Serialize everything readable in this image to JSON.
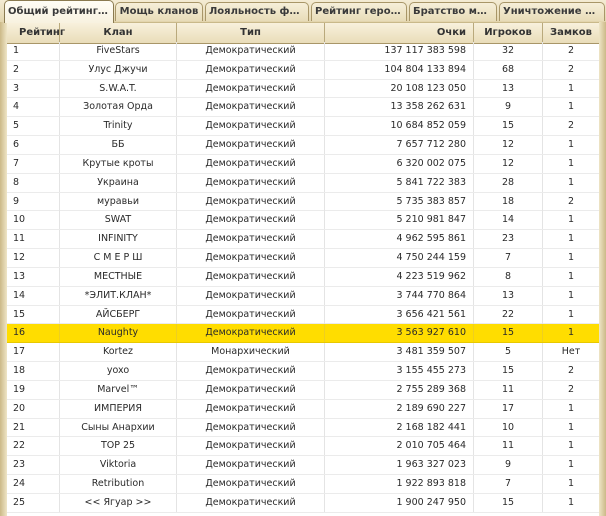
{
  "tabs": [
    {
      "label": "Общий рейтинг ...",
      "active": true
    },
    {
      "label": "Мощь кланов",
      "active": false
    },
    {
      "label": "Лояльность фр...",
      "active": false
    },
    {
      "label": "Рейтинг героев",
      "active": false
    },
    {
      "label": "Братство меча",
      "active": false
    },
    {
      "label": "Уничтожение р...",
      "active": false
    }
  ],
  "columns": {
    "rank": "Рейтинг",
    "clan": "Клан",
    "type": "Тип",
    "points": "Очки",
    "players": "Игроков",
    "castles": "Замков"
  },
  "highlight_color": "#ffdd00",
  "rows": [
    {
      "rank": "1",
      "clan": "FiveStars",
      "type": "Демократический",
      "points": "137 117 383 598",
      "players": "32",
      "castles": "2"
    },
    {
      "rank": "2",
      "clan": "Улус Джучи",
      "type": "Демократический",
      "points": "104 804 133 894",
      "players": "68",
      "castles": "2"
    },
    {
      "rank": "3",
      "clan": "S.W.A.T.",
      "type": "Демократический",
      "points": "20 108 123 050",
      "players": "13",
      "castles": "1"
    },
    {
      "rank": "4",
      "clan": "Золотая Орда",
      "type": "Демократический",
      "points": "13 358 262 631",
      "players": "9",
      "castles": "1"
    },
    {
      "rank": "5",
      "clan": "Trinity",
      "type": "Демократический",
      "points": "10 684 852 059",
      "players": "15",
      "castles": "2"
    },
    {
      "rank": "6",
      "clan": "ББ",
      "type": "Демократический",
      "points": "7 657 712 280",
      "players": "12",
      "castles": "1"
    },
    {
      "rank": "7",
      "clan": "Крутые кроты",
      "type": "Демократический",
      "points": "6 320 002 075",
      "players": "12",
      "castles": "1"
    },
    {
      "rank": "8",
      "clan": "Украина",
      "type": "Демократический",
      "points": "5 841 722 383",
      "players": "28",
      "castles": "1"
    },
    {
      "rank": "9",
      "clan": "муравьи",
      "type": "Демократический",
      "points": "5 735 383 857",
      "players": "18",
      "castles": "2"
    },
    {
      "rank": "10",
      "clan": "SWAT",
      "type": "Демократический",
      "points": "5 210 981 847",
      "players": "14",
      "castles": "1"
    },
    {
      "rank": "11",
      "clan": "INFINITY",
      "type": "Демократический",
      "points": "4 962 595 861",
      "players": "23",
      "castles": "1"
    },
    {
      "rank": "12",
      "clan": "С М Е Р Ш",
      "type": "Демократический",
      "points": "4 750 244 159",
      "players": "7",
      "castles": "1"
    },
    {
      "rank": "13",
      "clan": "МЕСТНЫЕ",
      "type": "Демократический",
      "points": "4 223 519 962",
      "players": "8",
      "castles": "1"
    },
    {
      "rank": "14",
      "clan": "*ЭЛИТ.КЛАН*",
      "type": "Демократический",
      "points": "3 744 770 864",
      "players": "13",
      "castles": "1"
    },
    {
      "rank": "15",
      "clan": "АЙСБЕРГ",
      "type": "Демократический",
      "points": "3 656 421 561",
      "players": "22",
      "castles": "1"
    },
    {
      "rank": "16",
      "clan": "Naughty",
      "type": "Демократический",
      "points": "3 563 927 610",
      "players": "15",
      "castles": "1",
      "highlighted": true
    },
    {
      "rank": "17",
      "clan": "Kortez",
      "type": "Монархический",
      "points": "3 481 359 507",
      "players": "5",
      "castles": "Нет"
    },
    {
      "rank": "18",
      "clan": "yoxo",
      "type": "Демократический",
      "points": "3 155 455 273",
      "players": "15",
      "castles": "2"
    },
    {
      "rank": "19",
      "clan": "Marvel™",
      "type": "Демократический",
      "points": "2 755 289 368",
      "players": "11",
      "castles": "2"
    },
    {
      "rank": "20",
      "clan": "ИМПЕРИЯ",
      "type": "Демократический",
      "points": "2 189 690 227",
      "players": "17",
      "castles": "1"
    },
    {
      "rank": "21",
      "clan": "Сыны Анархии",
      "type": "Демократический",
      "points": "2 168 182 441",
      "players": "10",
      "castles": "1"
    },
    {
      "rank": "22",
      "clan": "TOP 25",
      "type": "Демократический",
      "points": "2 010 705 464",
      "players": "11",
      "castles": "1"
    },
    {
      "rank": "23",
      "clan": "Viktoria",
      "type": "Демократический",
      "points": "1 963 327 023",
      "players": "9",
      "castles": "1"
    },
    {
      "rank": "24",
      "clan": "Retribution",
      "type": "Демократический",
      "points": "1 922 893 818",
      "players": "7",
      "castles": "1"
    },
    {
      "rank": "25",
      "clan": "<< Ягуар >>",
      "type": "Демократический",
      "points": "1 900 247 950",
      "players": "15",
      "castles": "1"
    }
  ]
}
